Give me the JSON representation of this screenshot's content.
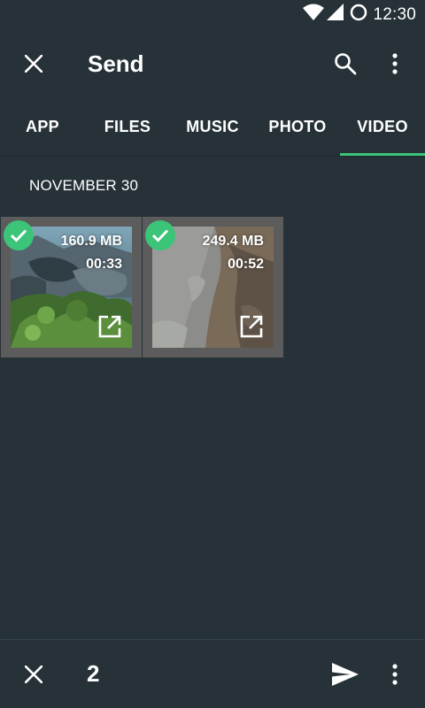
{
  "status_bar": {
    "time": "12:30",
    "icons": [
      "wifi-icon",
      "signal-icon",
      "battery-circle-icon"
    ]
  },
  "app_bar": {
    "title": "Send",
    "close_icon": "close-icon",
    "search_icon": "search-icon",
    "more_icon": "more-vert-icon"
  },
  "tabs": [
    {
      "label": "APP",
      "active": false
    },
    {
      "label": "FILES",
      "active": false
    },
    {
      "label": "MUSIC",
      "active": false
    },
    {
      "label": "PHOTO",
      "active": false
    },
    {
      "label": "VIDEO",
      "active": true
    }
  ],
  "section": {
    "date_header": "NOVEMBER 30"
  },
  "videos": [
    {
      "size": "160.9 MB",
      "duration": "00:33",
      "selected": true
    },
    {
      "size": "249.4 MB",
      "duration": "00:52",
      "selected": true
    }
  ],
  "bottom_bar": {
    "selected_count": "2",
    "cancel_icon": "close-icon",
    "send_icon": "send-icon",
    "more_icon": "more-vert-icon"
  },
  "colors": {
    "background": "#263238",
    "accent": "#3cc479",
    "card": "#5c5c5c"
  }
}
